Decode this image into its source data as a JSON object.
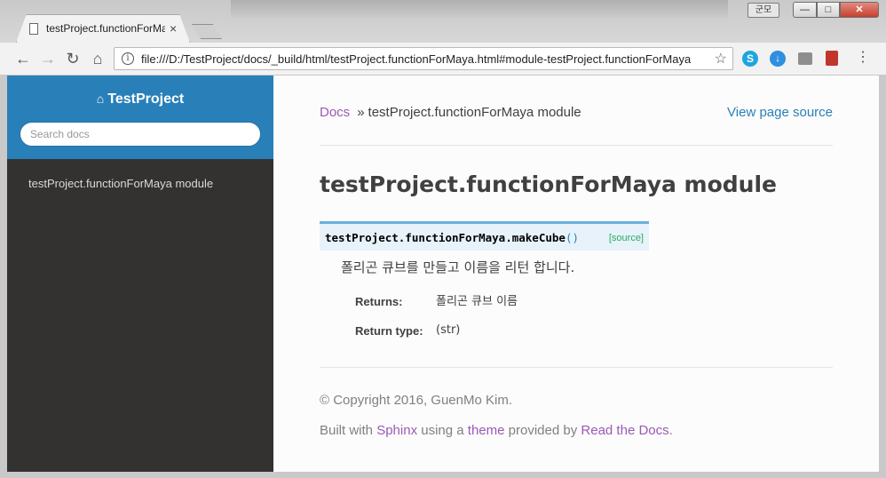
{
  "browser": {
    "tab_title": "testProject.functionForMaya",
    "tab_close": "×",
    "profile_label": "군모",
    "url": "file:///D:/TestProject/docs/_build/html/testProject.functionForMaya.html#module-testProject.functionForMaya",
    "info_glyph": "i",
    "star_glyph": "☆",
    "back_glyph": "←",
    "forward_glyph": "→",
    "reload_glyph": "↻",
    "home_glyph": "⌂",
    "menu_glyph": "⋮",
    "extensions": [
      {
        "name": "skype-icon",
        "glyph": "S",
        "color": "#1ea5e0"
      },
      {
        "name": "download-icon",
        "glyph": "↓",
        "color": "#2f8fe0"
      },
      {
        "name": "shirt-icon",
        "glyph": "",
        "color": "#8e8e8e"
      },
      {
        "name": "book-icon",
        "glyph": "",
        "color": "#c2352b"
      }
    ],
    "window_buttons": {
      "minimize": "—",
      "maximize": "□",
      "close": "✕"
    }
  },
  "sidebar": {
    "home_icon": "⌂",
    "project_name": "TestProject",
    "search_placeholder": "Search docs",
    "nav_items": [
      "testProject.functionForMaya module"
    ],
    "accent_color": "#2980b9",
    "background_color": "#343131"
  },
  "header": {
    "breadcrumb_root": "Docs",
    "breadcrumb_separator": "»",
    "breadcrumb_current": "testProject.functionForMaya module",
    "view_source": "View page source"
  },
  "main": {
    "title": "testProject.functionForMaya module",
    "function": {
      "signature": "testProject.functionForMaya.makeCube",
      "parens": "()",
      "source_label": "[source]",
      "description": "폴리곤 큐브를 만들고 이름을 리턴 합니다.",
      "fields": [
        {
          "label": "Returns:",
          "value": "폴리곤 큐브 이름"
        },
        {
          "label": "Return type:",
          "value": "(str)"
        }
      ]
    }
  },
  "footer": {
    "copyright": "© Copyright 2016, GuenMo Kim.",
    "built_prefix": "Built with",
    "sphinx": "Sphinx",
    "using_a": "using a",
    "theme": "theme",
    "provided_by": "provided by",
    "rtd": "Read the Docs",
    "period": "."
  }
}
